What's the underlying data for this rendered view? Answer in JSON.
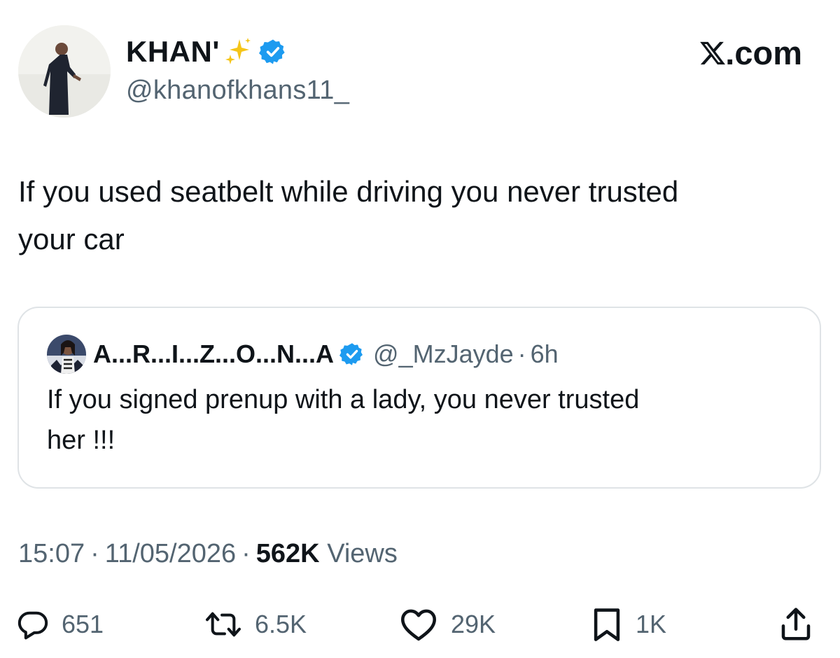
{
  "tweet": {
    "author": {
      "display_name": "KHAN'",
      "emoji": "sparkles-emoji",
      "handle": "@khanofkhans11_",
      "verified": true
    },
    "brand": {
      "logo": "x-logo-icon",
      "suffix": ".com"
    },
    "text_lines": [
      "If you used seatbelt while driving you never trusted",
      "your car"
    ],
    "quote": {
      "display_name": "A...R...I...Z...O...N...A",
      "handle": "@_MzJayde",
      "separator": "·",
      "time": "6h",
      "verified": true,
      "text_lines": [
        "If you signed prenup with a lady, you never trusted",
        "her !!!"
      ]
    },
    "meta": {
      "time": "15:07",
      "separator": "·",
      "date": "11/05/2026",
      "views_count": "562K",
      "views_label": "Views"
    },
    "actions": {
      "replies": "651",
      "reposts": "6.5K",
      "likes": "29K",
      "bookmarks": "1K"
    }
  },
  "colors": {
    "text_primary": "#0f1419",
    "text_secondary": "#536471",
    "verified_blue": "#1d9bf0",
    "border": "#dfe3e6",
    "sparkle": "#f5c518"
  }
}
